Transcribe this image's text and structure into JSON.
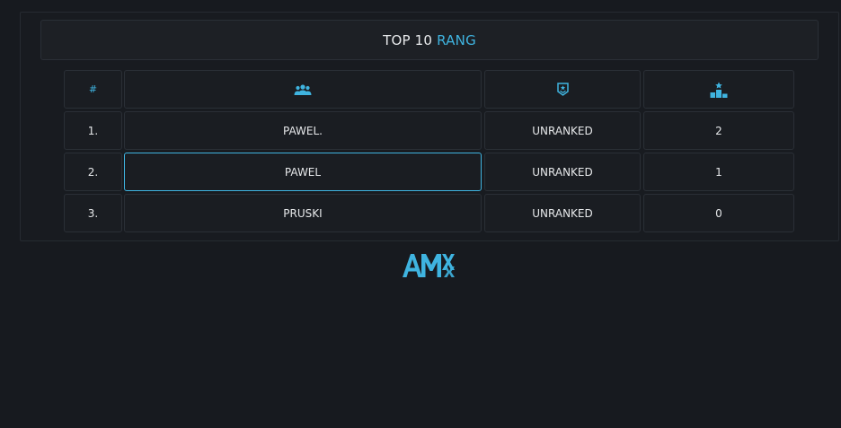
{
  "title": {
    "part1": "TOP 10",
    "part2": "RANG"
  },
  "table": {
    "headers": {
      "rank": "#",
      "player_icon": "users-icon",
      "rank_icon": "shield-badge-icon",
      "points_icon": "podium-icon"
    },
    "rows": [
      {
        "pos": "1.",
        "name": "PAWEL.",
        "rank": "UNRANKED",
        "points": "2"
      },
      {
        "pos": "2.",
        "name": "PAWEL",
        "rank": "UNRANKED",
        "points": "1"
      },
      {
        "pos": "3.",
        "name": "PRUSKI",
        "rank": "UNRANKED",
        "points": "0"
      }
    ]
  },
  "footer": {
    "logo_icon": "amx-logo-icon"
  },
  "colors": {
    "accent": "#3fb4e0",
    "background": "#171a1f",
    "cell": "#1a1d22",
    "border": "#2a2f36"
  }
}
